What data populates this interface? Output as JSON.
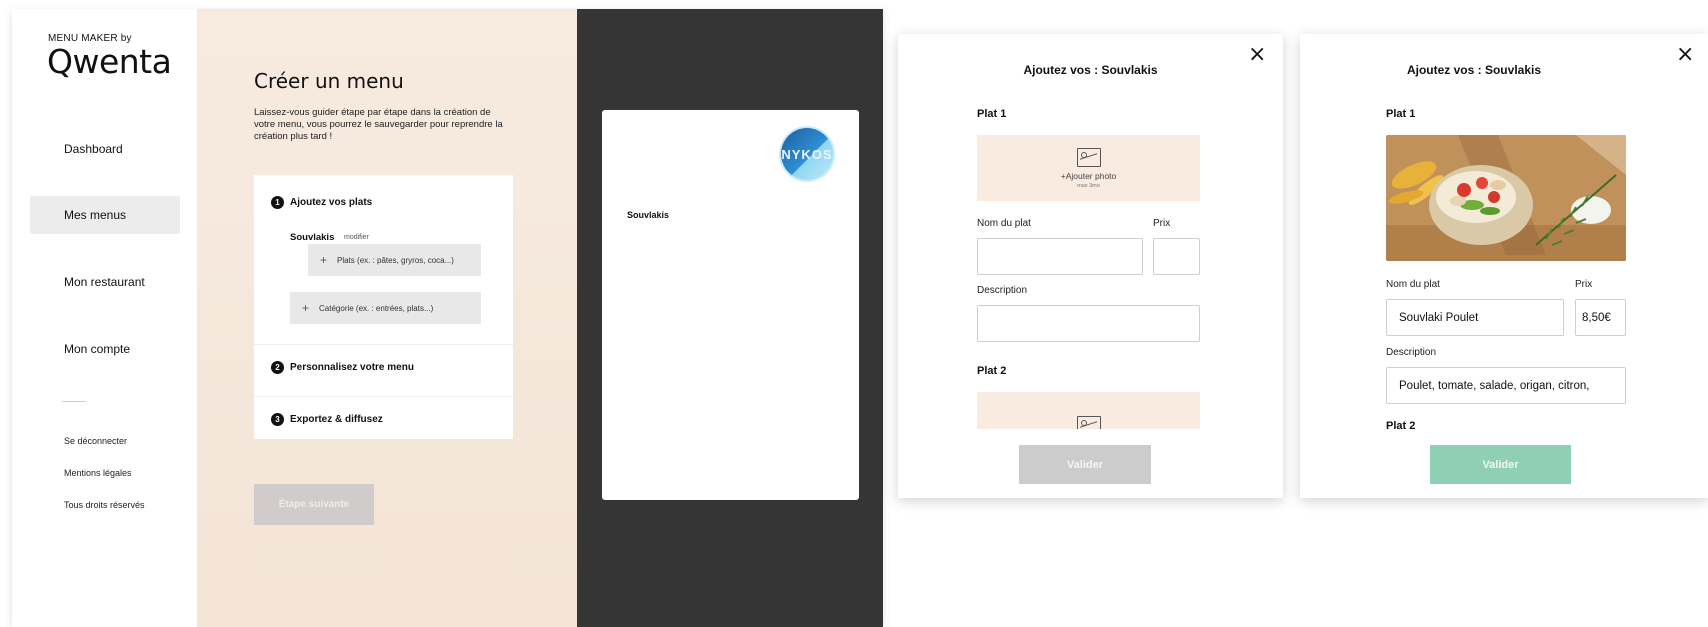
{
  "brand": {
    "small": "MENU MAKER by",
    "name": "Qwenta"
  },
  "sidebar": {
    "items": [
      {
        "label": "Dashboard"
      },
      {
        "label": "Mes menus"
      },
      {
        "label": "Mon restaurant"
      },
      {
        "label": "Mon compte"
      }
    ],
    "footer_links": [
      {
        "label": "Se déconnecter"
      },
      {
        "label": "Mentions légales"
      },
      {
        "label": "Tous droits réservés"
      }
    ]
  },
  "main": {
    "title": "Créer un menu",
    "intro": "Laissez-vous guider étape par étape dans la création de votre menu, vous pourrez le sauvegarder pour reprendre la création plus tard !",
    "steps": [
      {
        "num": "1",
        "label": "Ajoutez vos plats"
      },
      {
        "num": "2",
        "label": "Personnalisez votre menu"
      },
      {
        "num": "3",
        "label": "Exportez & diffusez"
      }
    ],
    "category": {
      "name": "Souvlakis",
      "edit": "modifier"
    },
    "add_dish": "Plats (ex. : pâtes, gryros, coca...)",
    "add_category": "Catégorie (ex. : entrées, plats...)",
    "next_button": "Étape suivante"
  },
  "preview": {
    "logo_text": "NYKOS",
    "category": "Souvlakis"
  },
  "modal_empty": {
    "title": "Ajoutez vos : Souvlakis",
    "close_icon": "×",
    "dish1_label": "Plat 1",
    "photo_text": "+Ajouter photo",
    "photo_sub": "max 3mo",
    "name_label": "Nom du plat",
    "price_label": "Prix",
    "desc_label": "Description",
    "dish2_label": "Plat 2",
    "name_value": "",
    "price_value": "",
    "desc_value": "",
    "submit": "Valider",
    "submit_color": "#cccccc"
  },
  "modal_filled": {
    "title": "Ajoutez vos : Souvlakis",
    "close_icon": "×",
    "dish1_label": "Plat 1",
    "name_label": "Nom du plat",
    "price_label": "Prix",
    "desc_label": "Description",
    "dish2_label": "Plat 2",
    "name_value": "Souvlaki Poulet",
    "price_value": "8,50€",
    "desc_value": "Poulet, tomate, salade, origan, citron,",
    "submit": "Valider",
    "submit_color": "#8fd0b4"
  }
}
